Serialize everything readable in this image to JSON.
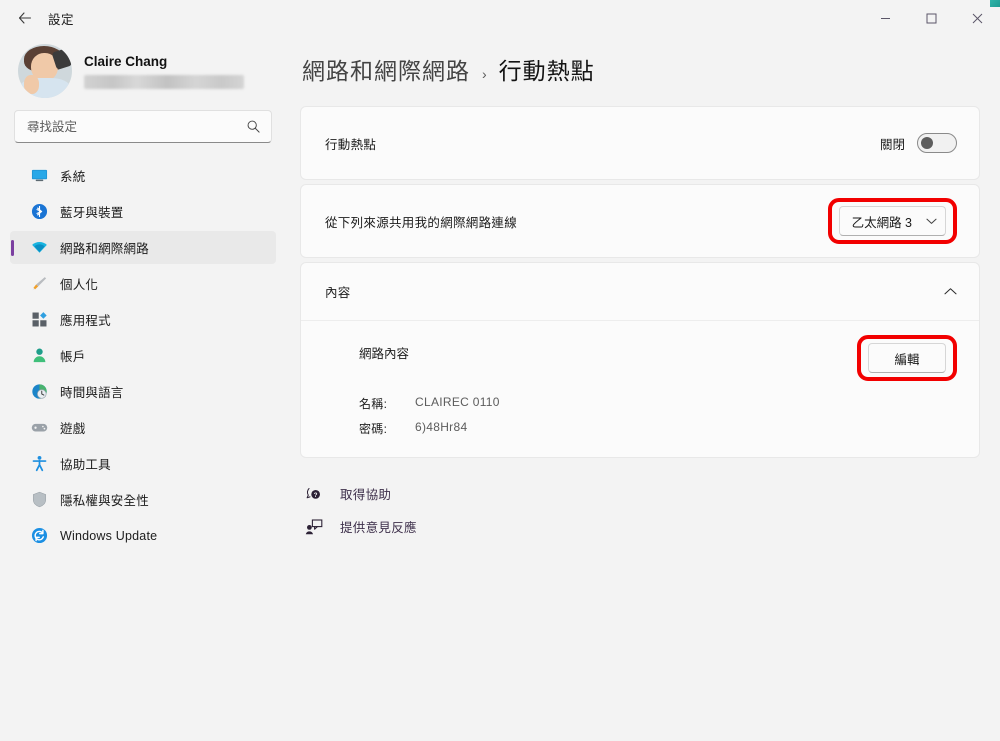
{
  "window": {
    "app_title": "設定",
    "back_icon": "back-arrow-icon",
    "minimize_label": "–",
    "maximize_label": "☐",
    "close_label": "✕"
  },
  "sidebar": {
    "profile": {
      "name": "Claire Chang",
      "email_redacted": ""
    },
    "search": {
      "placeholder": "尋找設定",
      "value": "",
      "icon": "search-icon"
    },
    "items": [
      {
        "label": "系統",
        "icon": "system-monitor-icon",
        "selected": false
      },
      {
        "label": "藍牙與裝置",
        "icon": "bluetooth-icon",
        "selected": false
      },
      {
        "label": "網路和網際網路",
        "icon": "wifi-icon",
        "selected": true
      },
      {
        "label": "個人化",
        "icon": "paintbrush-icon",
        "selected": false
      },
      {
        "label": "應用程式",
        "icon": "apps-grid-icon",
        "selected": false
      },
      {
        "label": "帳戶",
        "icon": "user-account-icon",
        "selected": false
      },
      {
        "label": "時間與語言",
        "icon": "clock-globe-icon",
        "selected": false
      },
      {
        "label": "遊戲",
        "icon": "gamepad-icon",
        "selected": false
      },
      {
        "label": "協助工具",
        "icon": "accessibility-icon",
        "selected": false
      },
      {
        "label": "隱私權與安全性",
        "icon": "shield-icon",
        "selected": false
      },
      {
        "label": "Windows Update",
        "icon": "update-sync-icon",
        "selected": false
      }
    ]
  },
  "main": {
    "breadcrumb": {
      "root": "網路和網際網路",
      "separator": "›",
      "current": "行動熱點"
    },
    "hotspot_row": {
      "label": "行動熱點",
      "toggle_state_label": "關閉",
      "toggle_on": false
    },
    "share_row": {
      "label": "從下列來源共用我的網際網路連線",
      "dropdown_value": "乙太網路 3",
      "dropdown_icon": "chevron-down-icon",
      "highlighted": true
    },
    "properties_section": {
      "title": "內容",
      "expanded": true,
      "collapse_icon": "chevron-up-icon",
      "network_properties_label": "網路內容",
      "edit_button_label": "編輯",
      "edit_highlighted": true,
      "fields": [
        {
          "key": "名稱:",
          "value": "CLAIREC 0110"
        },
        {
          "key": "密碼:",
          "value": "6)48Hr84"
        }
      ]
    },
    "links": [
      {
        "label": "取得協助",
        "icon": "help-question-icon"
      },
      {
        "label": "提供意見反應",
        "icon": "feedback-person-icon"
      }
    ]
  },
  "colors": {
    "accent_purple": "#7b3fa0",
    "annotation_red": "#f20000",
    "page_bg": "#f3f3f3",
    "card_bg": "#fbfbfb"
  }
}
